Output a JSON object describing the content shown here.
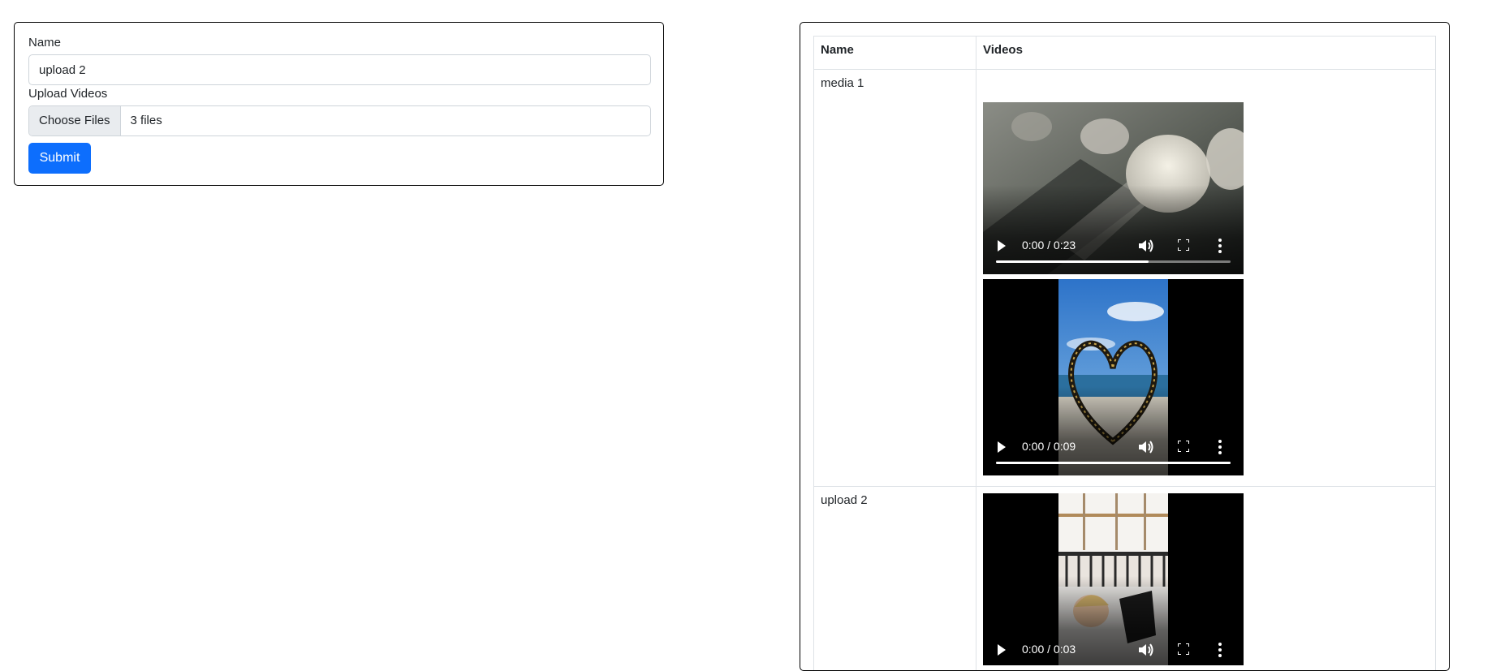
{
  "form": {
    "name_label": "Name",
    "name_value": "upload 2",
    "upload_label": "Upload Videos",
    "choose_files_label": "Choose Files",
    "file_status": "3 files",
    "submit_label": "Submit"
  },
  "table": {
    "headers": [
      "Name",
      "Videos"
    ],
    "rows": [
      {
        "name": "media 1",
        "videos": [
          {
            "time": "0:00 / 0:23",
            "buffered": 0.65
          },
          {
            "time": "0:00 / 0:09",
            "buffered": 1.0
          }
        ]
      },
      {
        "name": "upload 2",
        "videos": [
          {
            "time": "0:00 / 0:03",
            "buffered": 1.0
          }
        ]
      }
    ]
  },
  "icons": [
    "play-icon",
    "volume-icon",
    "fullscreen-icon",
    "more-options-icon"
  ],
  "colors": {
    "primary": "#0d6efd",
    "border": "#dee2e6",
    "input_border": "#ced4da"
  }
}
